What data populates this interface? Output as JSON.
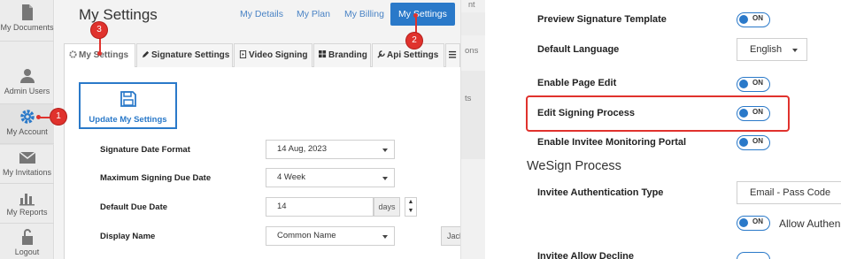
{
  "sidebar": {
    "items": [
      {
        "label": "My Documents",
        "icon": "document-icon"
      },
      {
        "label": "Admin Users",
        "icon": "user-icon"
      },
      {
        "label": "My Account",
        "icon": "gear-icon"
      },
      {
        "label": "My Invitations",
        "icon": "envelope-icon"
      },
      {
        "label": "My Reports",
        "icon": "bar-chart-icon"
      },
      {
        "label": "Logout",
        "icon": "lock-icon"
      }
    ]
  },
  "header": {
    "title": "My Settings",
    "tabs": [
      "My Details",
      "My Plan",
      "My Billing",
      "My Settings"
    ]
  },
  "settings_tabs": [
    "My Settings",
    "Signature Settings",
    "Video Signing",
    "Branding",
    "Api Settings"
  ],
  "update_button": "Update My Settings",
  "form": {
    "signature_date_format": {
      "label": "Signature Date Format",
      "value": "14 Aug, 2023"
    },
    "max_signing_due_date": {
      "label": "Maximum Signing Due Date",
      "value": "4 Week"
    },
    "default_due_date": {
      "label": "Default Due Date",
      "value": "14",
      "addon": "days"
    },
    "display_name": {
      "label": "Display Name",
      "value": "Common Name",
      "extra": "Jackso"
    }
  },
  "badges": [
    "1",
    "2",
    "3"
  ],
  "mid_strip": {
    "top": "nt",
    "a": "ons",
    "b": "ts"
  },
  "right": {
    "rows": [
      {
        "label": "Preview Signature Template",
        "state": "ON"
      },
      {
        "label": "Default Language",
        "value": "English"
      },
      {
        "label": "Enable Page Edit",
        "state": "ON"
      },
      {
        "label": "Edit Signing Process",
        "state": "ON"
      },
      {
        "label": "Enable Invitee Monitoring Portal",
        "state": "ON"
      }
    ],
    "section_title": "WeSign Process",
    "invitee_auth": {
      "label": "Invitee Authentication Type",
      "value": "Email - Pass Code"
    },
    "allow_toggle": {
      "state": "ON",
      "text": "Allow Authen"
    },
    "bottom_label": "Invitee Allow Decline"
  },
  "colors": {
    "accent": "#2a79c9",
    "highlight": "#e0322d"
  }
}
